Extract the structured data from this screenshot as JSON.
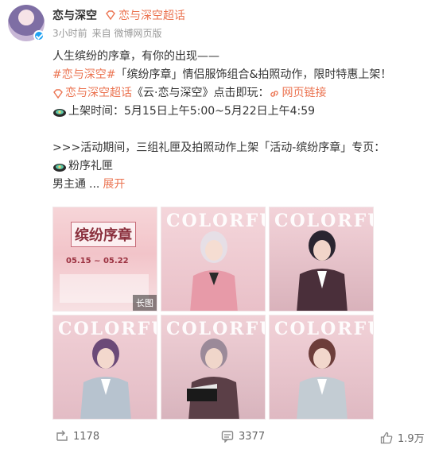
{
  "header": {
    "name": "恋与深空",
    "supertopic": "恋与深空超话",
    "time": "3小时前",
    "source": "来自 微博网页版"
  },
  "content": {
    "line1": "人生缤纷的序章，有你的出现——",
    "line2_tag": "#恋与深空#",
    "line2_rest": "「缤纷序章」情侣服饰组合&拍照动作，限时特惠上架！",
    "line3_link1": "恋与深空超话",
    "line3_mid": "《云·恋与深空》点击即玩：",
    "line3_link2": "网页链接",
    "line4": "上架时间：5月15日上午5:00~5月22日上午4:59",
    "line5": ">>>活动期间，三组礼匣及拍照动作上架「活动-缤纷序章」专页：",
    "line6": "粉序礼匣",
    "line7": "男主通",
    "ellipsis": "...",
    "expand": "展开"
  },
  "images": {
    "poster_title": "缤纷序章",
    "poster_date": "05.15 ~ 05.22",
    "long_image_label": "长图",
    "brand": "COLORFUL"
  },
  "footer": {
    "repost_count": "1178",
    "comment_count": "3377",
    "like_count": "1.9万"
  },
  "colors": {
    "accent": "#eb7350",
    "verified": "#1da1f2"
  }
}
